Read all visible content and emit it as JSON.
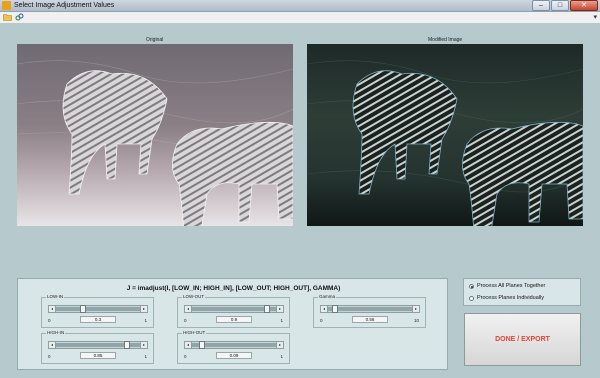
{
  "window": {
    "title": "Select Image Adjustment Values",
    "minimize_glyph": "–",
    "maximize_glyph": "□",
    "close_glyph": "✕"
  },
  "toolbar": {
    "icons": [
      "folder-icon",
      "link-icon"
    ],
    "menu_arrow": "▾"
  },
  "images": {
    "original_label": "Original",
    "modified_label": "Modified Image"
  },
  "formula": "J = imadjust(I, [LOW_IN; HIGH_IN], [LOW_OUT; HIGH_OUT], GAMMA)",
  "sliders": [
    {
      "id": "low-in",
      "label": "LOW-IN",
      "min": "0",
      "max": "1",
      "value": "0.3",
      "fraction": 0.3
    },
    {
      "id": "low-out",
      "label": "LOW-OUT",
      "min": "0",
      "max": "1",
      "value": "0.9",
      "fraction": 0.9
    },
    {
      "id": "gamma",
      "label": "Gamma",
      "min": "0",
      "max": "10",
      "value": "0.56",
      "fraction": 0.056
    },
    {
      "id": "high-in",
      "label": "HIGH-IN",
      "min": "0",
      "max": "1",
      "value": "0.85",
      "fraction": 0.85
    },
    {
      "id": "high-out",
      "label": "HIGH-OUT",
      "min": "0",
      "max": "1",
      "value": "0.09",
      "fraction": 0.09
    }
  ],
  "planes": {
    "option_together": "Process All Planes Together",
    "option_individual": "Process Planes Individually",
    "selected": "together"
  },
  "done_button": "DONE / EXPORT",
  "colors": {
    "background": "#b6c9cc",
    "panel": "#d9e6e8",
    "done_text": "#e0453a"
  }
}
